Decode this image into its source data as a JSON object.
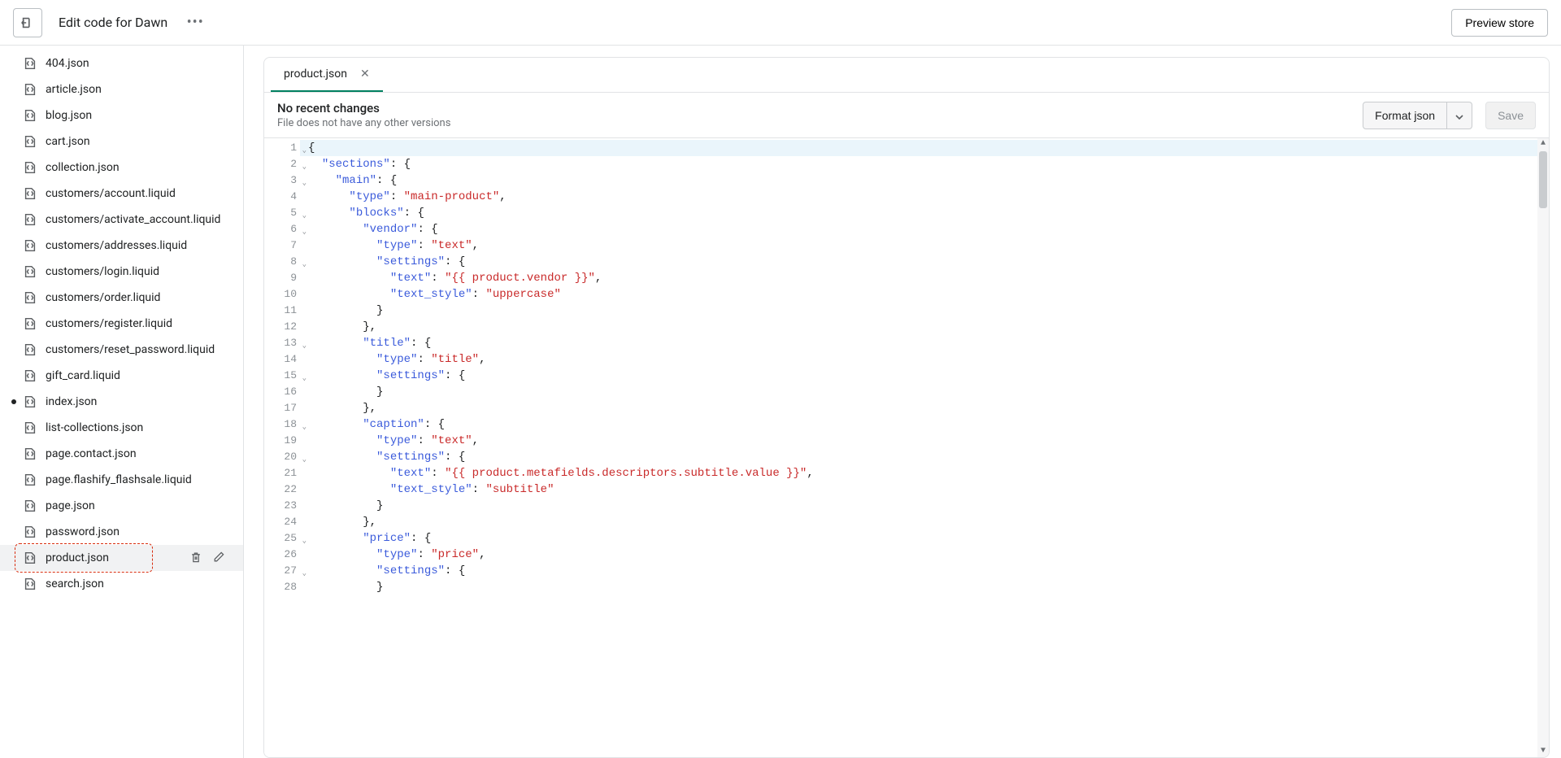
{
  "header": {
    "title": "Edit code for Dawn",
    "preview_label": "Preview store"
  },
  "sidebar": {
    "files": [
      {
        "name": "404.json"
      },
      {
        "name": "article.json"
      },
      {
        "name": "blog.json"
      },
      {
        "name": "cart.json"
      },
      {
        "name": "collection.json"
      },
      {
        "name": "customers/account.liquid"
      },
      {
        "name": "customers/activate_account.liquid"
      },
      {
        "name": "customers/addresses.liquid"
      },
      {
        "name": "customers/login.liquid"
      },
      {
        "name": "customers/order.liquid"
      },
      {
        "name": "customers/register.liquid"
      },
      {
        "name": "customers/reset_password.liquid"
      },
      {
        "name": "gift_card.liquid"
      },
      {
        "name": "index.json",
        "modified": true
      },
      {
        "name": "list-collections.json"
      },
      {
        "name": "page.contact.json"
      },
      {
        "name": "page.flashify_flashsale.liquid"
      },
      {
        "name": "page.json"
      },
      {
        "name": "password.json"
      },
      {
        "name": "product.json",
        "active": true
      },
      {
        "name": "search.json"
      }
    ]
  },
  "tab": {
    "label": "product.json"
  },
  "status": {
    "title": "No recent changes",
    "subtitle": "File does not have any other versions"
  },
  "buttons": {
    "format": "Format json",
    "save": "Save"
  },
  "code_lines": [
    {
      "n": 1,
      "fold": true,
      "hl": true,
      "tokens": [
        [
          "{",
          "punc"
        ]
      ]
    },
    {
      "n": 2,
      "fold": true,
      "tokens": [
        [
          "  ",
          ""
        ],
        [
          "\"sections\"",
          "key"
        ],
        [
          ": {",
          "punc"
        ]
      ]
    },
    {
      "n": 3,
      "fold": true,
      "tokens": [
        [
          "    ",
          ""
        ],
        [
          "\"main\"",
          "key"
        ],
        [
          ": {",
          "punc"
        ]
      ]
    },
    {
      "n": 4,
      "tokens": [
        [
          "      ",
          ""
        ],
        [
          "\"type\"",
          "key"
        ],
        [
          ": ",
          "punc"
        ],
        [
          "\"main-product\"",
          "str"
        ],
        [
          ",",
          "punc"
        ]
      ]
    },
    {
      "n": 5,
      "fold": true,
      "tokens": [
        [
          "      ",
          ""
        ],
        [
          "\"blocks\"",
          "key"
        ],
        [
          ": {",
          "punc"
        ]
      ]
    },
    {
      "n": 6,
      "fold": true,
      "tokens": [
        [
          "        ",
          ""
        ],
        [
          "\"vendor\"",
          "key"
        ],
        [
          ": {",
          "punc"
        ]
      ]
    },
    {
      "n": 7,
      "tokens": [
        [
          "          ",
          ""
        ],
        [
          "\"type\"",
          "key"
        ],
        [
          ": ",
          "punc"
        ],
        [
          "\"text\"",
          "str"
        ],
        [
          ",",
          "punc"
        ]
      ]
    },
    {
      "n": 8,
      "fold": true,
      "tokens": [
        [
          "          ",
          ""
        ],
        [
          "\"settings\"",
          "key"
        ],
        [
          ": {",
          "punc"
        ]
      ]
    },
    {
      "n": 9,
      "tokens": [
        [
          "            ",
          ""
        ],
        [
          "\"text\"",
          "key"
        ],
        [
          ": ",
          "punc"
        ],
        [
          "\"{{ product.vendor }}\"",
          "str"
        ],
        [
          ",",
          "punc"
        ]
      ]
    },
    {
      "n": 10,
      "tokens": [
        [
          "            ",
          ""
        ],
        [
          "\"text_style\"",
          "key"
        ],
        [
          ": ",
          "punc"
        ],
        [
          "\"uppercase\"",
          "str"
        ]
      ]
    },
    {
      "n": 11,
      "tokens": [
        [
          "          }",
          "punc"
        ]
      ]
    },
    {
      "n": 12,
      "tokens": [
        [
          "        },",
          "punc"
        ]
      ]
    },
    {
      "n": 13,
      "fold": true,
      "tokens": [
        [
          "        ",
          ""
        ],
        [
          "\"title\"",
          "key"
        ],
        [
          ": {",
          "punc"
        ]
      ]
    },
    {
      "n": 14,
      "tokens": [
        [
          "          ",
          ""
        ],
        [
          "\"type\"",
          "key"
        ],
        [
          ": ",
          "punc"
        ],
        [
          "\"title\"",
          "str"
        ],
        [
          ",",
          "punc"
        ]
      ]
    },
    {
      "n": 15,
      "fold": true,
      "tokens": [
        [
          "          ",
          ""
        ],
        [
          "\"settings\"",
          "key"
        ],
        [
          ": {",
          "punc"
        ]
      ]
    },
    {
      "n": 16,
      "tokens": [
        [
          "          }",
          "punc"
        ]
      ]
    },
    {
      "n": 17,
      "tokens": [
        [
          "        },",
          "punc"
        ]
      ]
    },
    {
      "n": 18,
      "fold": true,
      "tokens": [
        [
          "        ",
          ""
        ],
        [
          "\"caption\"",
          "key"
        ],
        [
          ": {",
          "punc"
        ]
      ]
    },
    {
      "n": 19,
      "tokens": [
        [
          "          ",
          ""
        ],
        [
          "\"type\"",
          "key"
        ],
        [
          ": ",
          "punc"
        ],
        [
          "\"text\"",
          "str"
        ],
        [
          ",",
          "punc"
        ]
      ]
    },
    {
      "n": 20,
      "fold": true,
      "tokens": [
        [
          "          ",
          ""
        ],
        [
          "\"settings\"",
          "key"
        ],
        [
          ": {",
          "punc"
        ]
      ]
    },
    {
      "n": 21,
      "tokens": [
        [
          "            ",
          ""
        ],
        [
          "\"text\"",
          "key"
        ],
        [
          ": ",
          "punc"
        ],
        [
          "\"{{ product.metafields.descriptors.subtitle.value }}\"",
          "str"
        ],
        [
          ",",
          "punc"
        ]
      ]
    },
    {
      "n": 22,
      "tokens": [
        [
          "            ",
          ""
        ],
        [
          "\"text_style\"",
          "key"
        ],
        [
          ": ",
          "punc"
        ],
        [
          "\"subtitle\"",
          "str"
        ]
      ]
    },
    {
      "n": 23,
      "tokens": [
        [
          "          }",
          "punc"
        ]
      ]
    },
    {
      "n": 24,
      "tokens": [
        [
          "        },",
          "punc"
        ]
      ]
    },
    {
      "n": 25,
      "fold": true,
      "tokens": [
        [
          "        ",
          ""
        ],
        [
          "\"price\"",
          "key"
        ],
        [
          ": {",
          "punc"
        ]
      ]
    },
    {
      "n": 26,
      "tokens": [
        [
          "          ",
          ""
        ],
        [
          "\"type\"",
          "key"
        ],
        [
          ": ",
          "punc"
        ],
        [
          "\"price\"",
          "str"
        ],
        [
          ",",
          "punc"
        ]
      ]
    },
    {
      "n": 27,
      "fold": true,
      "tokens": [
        [
          "          ",
          ""
        ],
        [
          "\"settings\"",
          "key"
        ],
        [
          ": {",
          "punc"
        ]
      ]
    },
    {
      "n": 28,
      "tokens": [
        [
          "          }",
          "punc"
        ]
      ]
    }
  ]
}
